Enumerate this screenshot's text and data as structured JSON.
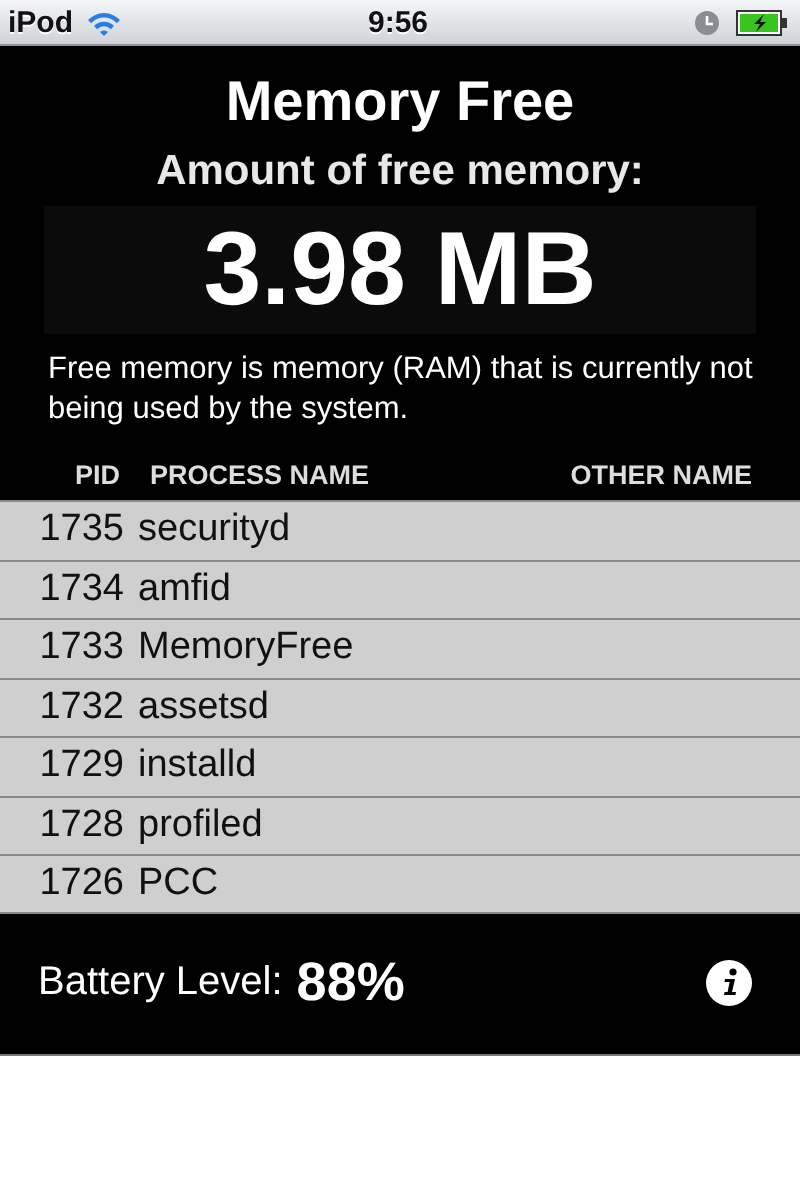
{
  "status_bar": {
    "carrier": "iPod",
    "time": "9:56"
  },
  "header": {
    "title": "Memory Free",
    "subtitle": "Amount of free memory:",
    "free_memory": "3.98 MB",
    "description": "Free memory is memory (RAM) that is currently not being used by the system."
  },
  "table": {
    "columns": [
      "PID",
      "PROCESS NAME",
      "OTHER NAME"
    ],
    "rows": [
      {
        "pid": "1735",
        "name": "securityd"
      },
      {
        "pid": "1734",
        "name": "amfid"
      },
      {
        "pid": "1733",
        "name": "MemoryFree"
      },
      {
        "pid": "1732",
        "name": "assetsd"
      },
      {
        "pid": "1729",
        "name": "installd"
      },
      {
        "pid": "1728",
        "name": "profiled"
      },
      {
        "pid": "1726",
        "name": "PCC"
      }
    ]
  },
  "footer": {
    "label": "Battery Level:",
    "value": "88%"
  }
}
